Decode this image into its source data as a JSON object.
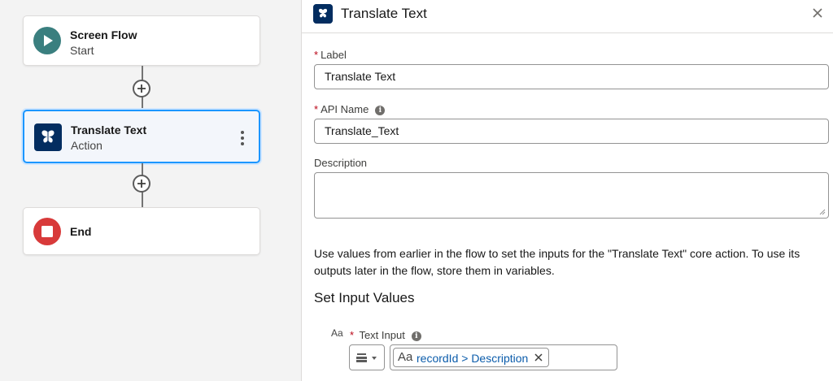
{
  "canvas": {
    "nodes": [
      {
        "title": "Screen Flow",
        "subtitle": "Start",
        "icon": "play-icon",
        "color": "#3a7f7f"
      },
      {
        "title": "Translate Text",
        "subtitle": "Action",
        "icon": "butterfly-action-icon",
        "color": "#032d60",
        "selected": true
      },
      {
        "title": "End",
        "subtitle": "",
        "icon": "stop-icon",
        "color": "#d83a3a"
      }
    ]
  },
  "panel": {
    "title": "Translate Text",
    "header_icon": "butterfly-action-icon",
    "fields": {
      "label": {
        "label": "Label",
        "value": "Translate Text",
        "required": "*"
      },
      "api_name": {
        "label": "API Name",
        "value": "Translate_Text",
        "required": "*",
        "info": "i"
      },
      "description": {
        "label": "Description",
        "value": ""
      }
    },
    "help_text": "Use values from earlier in the flow to set the inputs for the \"Translate Text\" core action. To use its outputs later in the flow, store them in variables.",
    "section_title": "Set Input Values",
    "text_input": {
      "type_icon": "Aa",
      "required": "*",
      "label": "Text Input",
      "info": "i",
      "pill_type": "Aa",
      "pill_value": "recordId > Description"
    }
  },
  "colors": {
    "accent": "#1b96ff",
    "link": "#0b5cab",
    "required": "#ba0517"
  }
}
